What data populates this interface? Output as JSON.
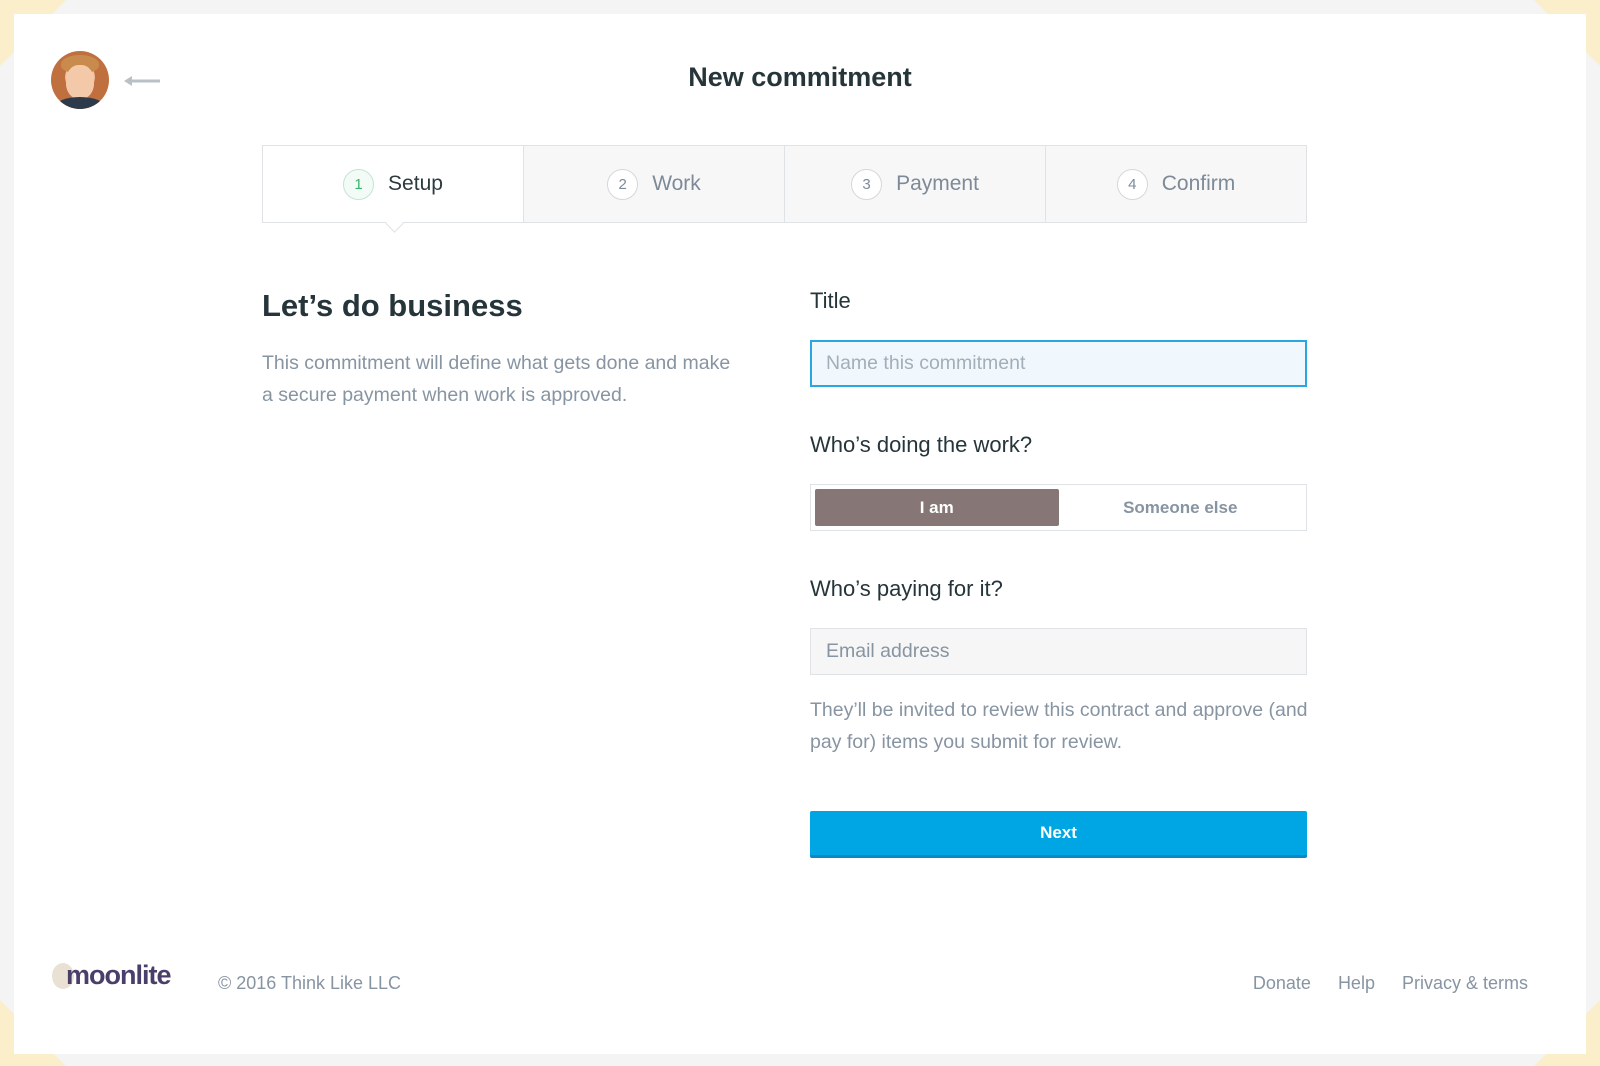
{
  "header": {
    "title": "New commitment",
    "back_icon": "arrow-left-icon",
    "avatar_alt": "user avatar"
  },
  "steps": [
    {
      "number": "1",
      "label": "Setup",
      "active": true
    },
    {
      "number": "2",
      "label": "Work",
      "active": false
    },
    {
      "number": "3",
      "label": "Payment",
      "active": false
    },
    {
      "number": "4",
      "label": "Confirm",
      "active": false
    }
  ],
  "intro": {
    "heading": "Let’s do business",
    "text": "This commitment will define what gets done and make a secure payment when work is approved."
  },
  "form": {
    "title_label": "Title",
    "title_placeholder": "Name this commitment",
    "title_value": "",
    "worker_label": "Who’s doing the work?",
    "worker_options": [
      "I am",
      "Someone else"
    ],
    "worker_selected": "I am",
    "payer_label": "Who’s paying for it?",
    "email_placeholder": "Email address",
    "email_value": "",
    "payer_help": "They’ll be invited to review this contract and approve (and pay for) items you submit for review.",
    "next_label": "Next"
  },
  "footer": {
    "logo": "moonlite",
    "copyright": "© 2016 Think Like LLC",
    "links": [
      "Donate",
      "Help",
      "Privacy & terms"
    ]
  },
  "colors": {
    "accent": "#00a6e4",
    "toggle_selected": "#877676",
    "step_active": "#36b66a",
    "corner": "#fbeecb"
  }
}
